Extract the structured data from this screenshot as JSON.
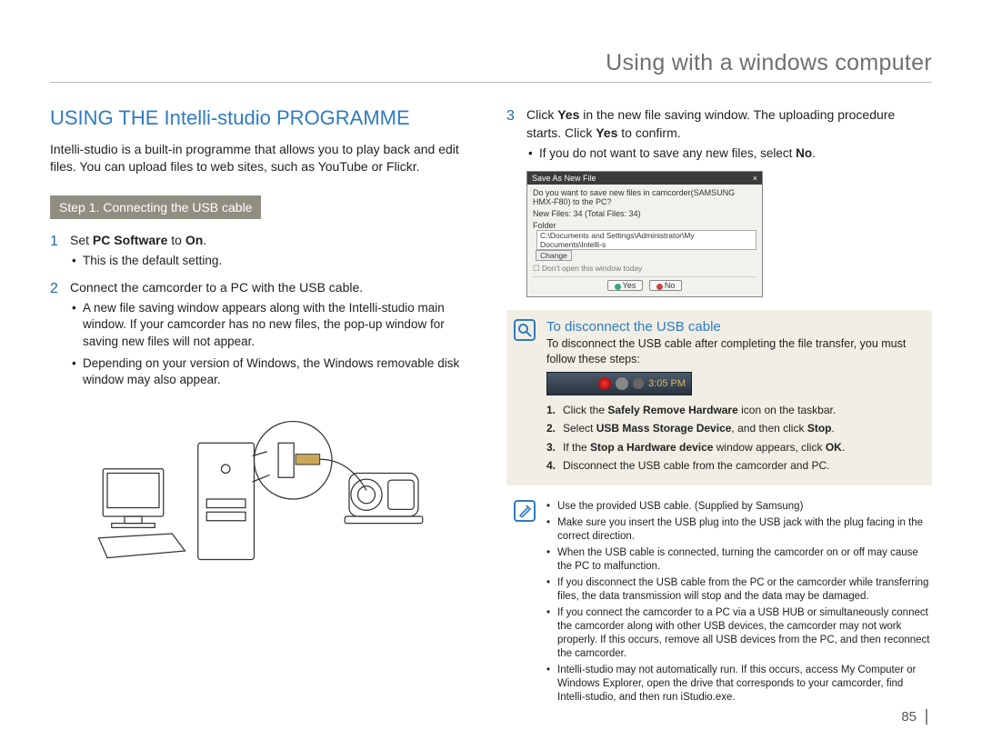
{
  "header": {
    "title": "Using with a windows computer"
  },
  "left": {
    "section_title": "USING THE Intelli-studio PROGRAMME",
    "intro": "Intelli-studio is a built-in programme that allows you to play back and edit files. You can upload files to web sites, such as YouTube or Flickr.",
    "step_bar": "Step 1. Connecting the USB cable",
    "s1_num": "1",
    "s1_pre": "Set ",
    "s1_bold": "PC Software",
    "s1_mid": " to ",
    "s1_bold2": "On",
    "s1_post": ".",
    "s1_b1": "This is the default setting.",
    "s2_num": "2",
    "s2_text": "Connect the camcorder to a PC with the USB cable.",
    "s2_b1": "A new file saving window appears along with the Intelli-studio main window. If your camcorder has no new files, the pop-up window for saving new files will not appear.",
    "s2_b2": "Depending on your version of Windows, the Windows removable disk window may also appear."
  },
  "right": {
    "s3_num": "3",
    "s3_a": "Click ",
    "s3_b1": "Yes",
    "s3_b": " in the new file saving window. The uploading procedure starts. Click ",
    "s3_b2": "Yes",
    "s3_c": " to confirm.",
    "s3_bul_a": "If you do not want to save any new files, select ",
    "s3_bul_b": "No",
    "s3_bul_c": ".",
    "dialog": {
      "title": "Save As New File",
      "close": "×",
      "question": "Do you want to save new files in camcorder(SAMSUNG HMX-F80) to the PC?",
      "newfiles": "New Files: 34 (Total Files: 34)",
      "folder_label": "Folder",
      "folder_path": "C:\\Documents and Settings\\Administrator\\My Documents\\Intelli-s",
      "change": "Change",
      "dont_open": "Don't open this window today",
      "yes": "Yes",
      "no": "No"
    },
    "disc": {
      "title": "To disconnect the USB cable",
      "sub": "To disconnect the USB cable after completing the file transfer, you must follow these steps:",
      "time": "3:05 PM",
      "st1_a": "Click the ",
      "st1_b": "Safely Remove Hardware",
      "st1_c": " icon on the taskbar.",
      "st2_a": "Select ",
      "st2_b": "USB Mass Storage Device",
      "st2_c": ", and then click ",
      "st2_d": "Stop",
      "st2_e": ".",
      "st3_a": "If the ",
      "st3_b": "Stop a Hardware device",
      "st3_c": " window appears, click ",
      "st3_d": "OK",
      "st3_e": ".",
      "st4": "Disconnect the USB cable from the camcorder and PC.",
      "n1": "1.",
      "n2": "2.",
      "n3": "3.",
      "n4": "4."
    },
    "notes": {
      "b1": "Use the provided USB cable. (Supplied by Samsung)",
      "b2": "Make sure you insert the USB plug into the USB jack with the plug facing in the correct direction.",
      "b3": "When the USB cable is connected, turning the camcorder on or off may cause the PC to malfunction.",
      "b4": "If you disconnect the USB cable from the PC or the camcorder while transferring files, the data transmission will stop and the data may be damaged.",
      "b5": "If you connect the camcorder to a PC via a USB HUB or simultaneously connect the camcorder along with other USB devices, the camcorder may not work properly. If this occurs, remove all USB devices from the PC, and then reconnect the camcorder.",
      "b6": "Intelli-studio may not automatically run. If this occurs, access My Computer or Windows Explorer, open the drive that corresponds to your camcorder, find Intelli-studio, and then run iStudio.exe."
    }
  },
  "page_number": "85"
}
